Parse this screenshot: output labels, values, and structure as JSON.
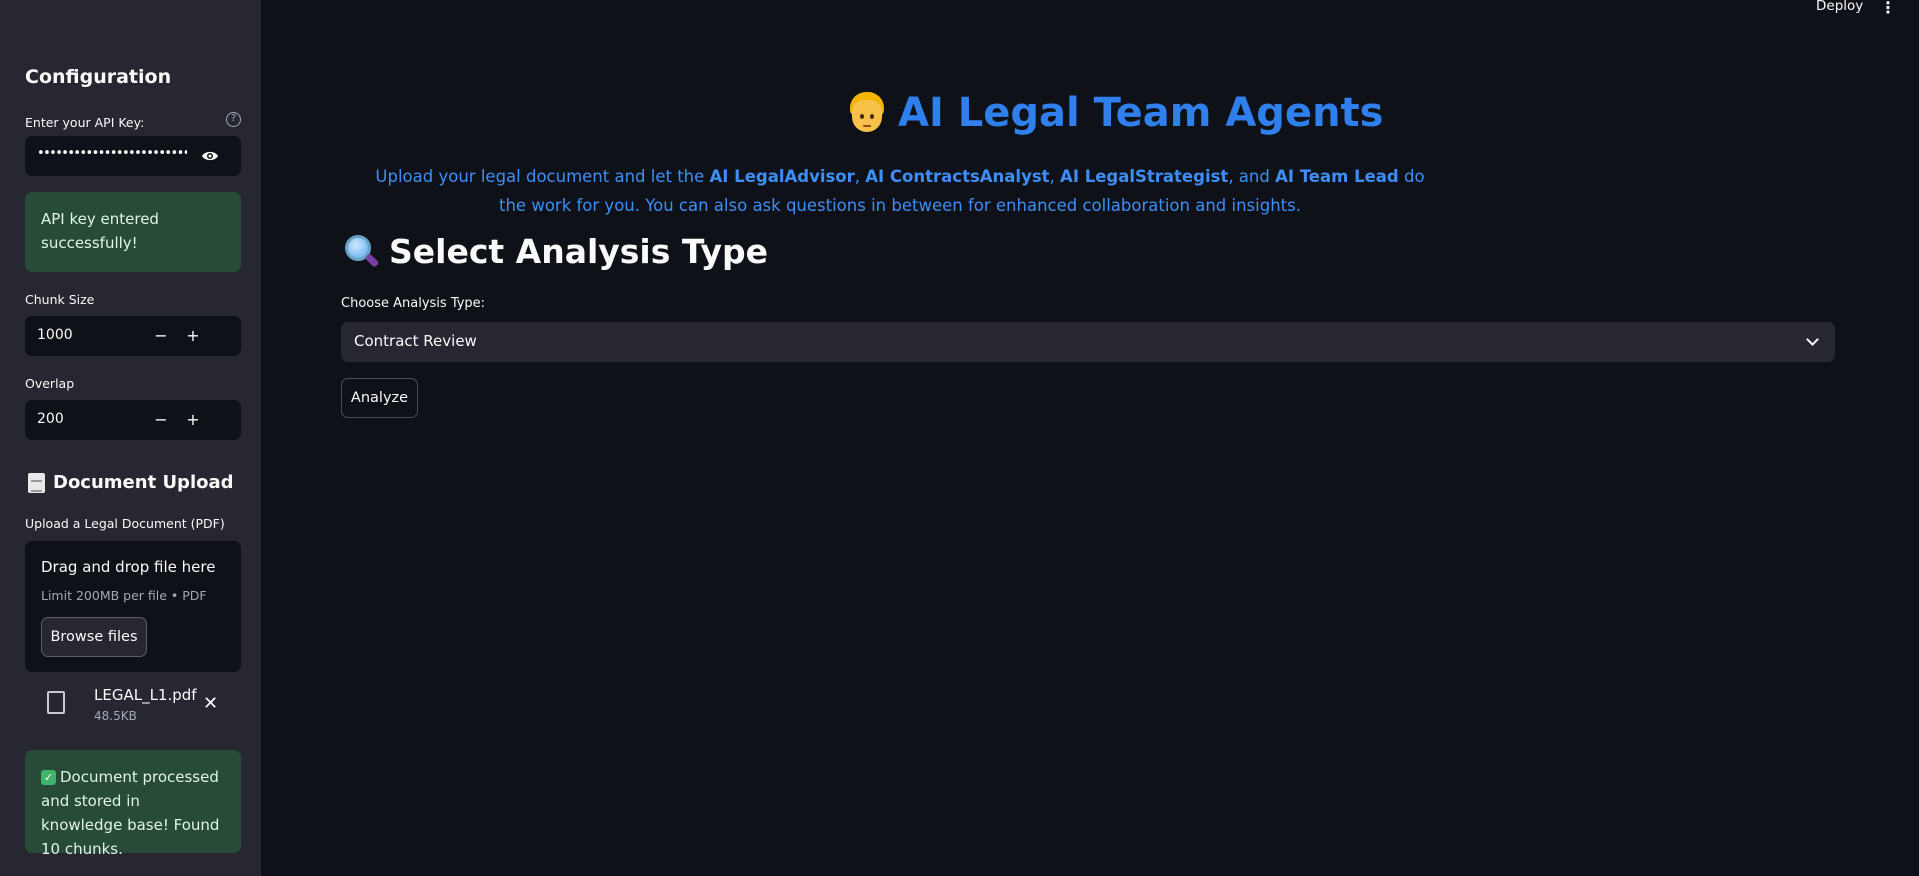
{
  "header": {
    "deploy_label": "Deploy",
    "menu_icon": "kebab-menu-icon"
  },
  "sidebar": {
    "title": "Configuration",
    "api_key": {
      "label": "Enter your API Key:",
      "value": "••••••••••••••••••••••••••••••••",
      "help_icon": "question-circle-icon",
      "toggle_icon": "eye-icon"
    },
    "api_success": "API key entered successfully!",
    "chunk_size": {
      "label": "Chunk Size",
      "value": "1000",
      "minus": "−",
      "plus": "+"
    },
    "overlap": {
      "label": "Overlap",
      "value": "200",
      "minus": "−",
      "plus": "+"
    },
    "upload_heading": "Document Upload",
    "upload_label": "Upload a Legal Document (PDF)",
    "dropzone": {
      "title": "Drag and drop file here",
      "limit": "Limit 200MB per file • PDF",
      "browse_label": "Browse files"
    },
    "file": {
      "name": "LEGAL_L1.pdf",
      "size": "48.5KB"
    },
    "processed_message": "Document processed and stored in knowledge base! Found 10 chunks."
  },
  "main": {
    "title": "AI Legal Team Agents",
    "intro": {
      "t1": "Upload your legal document and let the ",
      "b1": "AI LegalAdvisor",
      "t2": ", ",
      "b2": "AI ContractsAnalyst",
      "t3": ", ",
      "b3": "AI LegalStrategist",
      "t4": ", and ",
      "b4": "AI Team Lead",
      "t5": " do the work for you. You can also ask questions in between for enhanced collaboration and insights."
    },
    "section_title": "Select Analysis Type",
    "select_label": "Choose Analysis Type:",
    "select_value": "Contract Review",
    "analyze_label": "Analyze"
  },
  "colors": {
    "background": "#0e1117",
    "sidebar": "#262730",
    "accent_blue": "#2f80ed",
    "success_bg": "#274b37"
  }
}
